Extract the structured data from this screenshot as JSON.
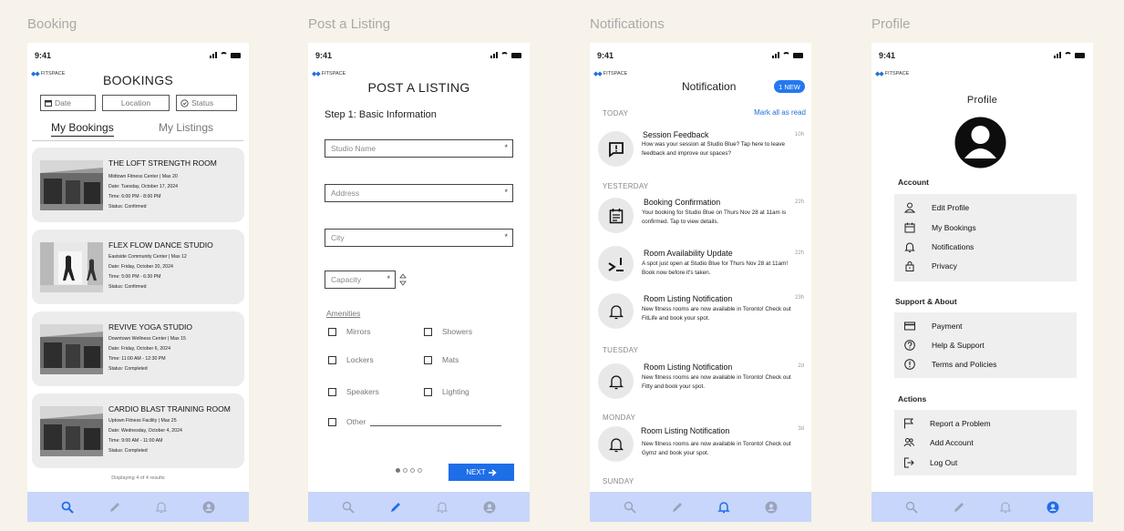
{
  "section_labels": {
    "booking": "Booking",
    "listing": "Post a Listing",
    "notifications": "Notifications",
    "profile": "Profile"
  },
  "status_time": "9:41",
  "brand": "FITSPACE",
  "colors": {
    "accent": "#1e6ee8",
    "navbar": "#c9d6fb",
    "background": "#f7f3ea",
    "card": "#ececec"
  },
  "booking": {
    "title": "BOOKINGS",
    "filters": [
      {
        "icon": "calendar-icon",
        "label": "Date"
      },
      {
        "label": "Location"
      },
      {
        "icon": "status-icon",
        "label": "Status"
      }
    ],
    "tabs": {
      "active": "My Bookings",
      "inactive": "My Listings"
    },
    "cards": [
      {
        "title": "THE LOFT STRENGTH ROOM",
        "lines": [
          "Midtown Fitness Center | Max 20",
          "Date: Tuesday, October 17, 2024",
          "Time: 6:00 PM - 8:00 PM",
          "Status: Confirmed"
        ]
      },
      {
        "title": "FLEX FLOW DANCE STUDIO",
        "lines": [
          "Eastside Community Center | Max 12",
          "Date: Friday, October 20, 2024",
          "Time: 5:00 PM - 6:30 PM",
          "Status: Confirmed"
        ]
      },
      {
        "title": "REVIVE YOGA STUDIO",
        "lines": [
          "Downtown Wellness Center | Max 15",
          "Date: Friday, October 6, 2024",
          "Time: 11:00 AM - 12:30 PM",
          "Status: Completed"
        ]
      },
      {
        "title": "CARDIO BLAST TRAINING ROOM",
        "lines": [
          "Uptown Fitness Facility | Max 25",
          "Date: Wednesday, October 4, 2024",
          "Time: 9:00 AM - 11:00 AM",
          "Status: Completed"
        ]
      }
    ],
    "results": "Displaying 4 of 4 results"
  },
  "listing": {
    "title": "POST A LISTING",
    "step": "Step 1: Basic Information",
    "fields": {
      "studio": "Studio Name",
      "address": "Address",
      "city": "City",
      "capacity": "Capacity",
      "required": "*"
    },
    "amenities_title": "Amenities",
    "amenities": [
      "Mirrors",
      "Showers",
      "Lockers",
      "Mats",
      "Speakers",
      "Lighting",
      "Other"
    ],
    "next": "NEXT",
    "page_indicator": {
      "total": 4,
      "current": 1
    }
  },
  "notifications": {
    "title": "Notification",
    "badge": "1 NEW",
    "mark_all": "Mark all as read",
    "days": [
      "TODAY",
      "YESTERDAY",
      "TUESDAY",
      "MONDAY",
      "SUNDAY"
    ],
    "items": [
      {
        "title": "Session Feedback",
        "body": "How was your session at Studio Blue? Tap here to leave feedback and improve our spaces?",
        "time": "10h",
        "icon": "feedback-icon"
      },
      {
        "title": "Booking Confirmation",
        "body": "Your booking for Studio Blue on Thurs Nov 28 at 11am is confirmed. Tap to view details.",
        "time": "22h",
        "icon": "calendar-icon"
      },
      {
        "title": "Room Availability Update",
        "body": "A spot just open at Studio Blue for Thurs Nov 28 at 11am! Book now before it's taken.",
        "time": "22h",
        "icon": "availability-icon"
      },
      {
        "title": "Room Listing Notification",
        "body": "New fitness rooms are now available in Toronto! Check out FitLife and book your spot.",
        "time": "23h",
        "icon": "bell-icon"
      },
      {
        "title": "Room Listing Notification",
        "body": "New fitness rooms are now available in Toronto! Check out Fitty and book your spot.",
        "time": "2d",
        "icon": "bell-icon"
      },
      {
        "title": "Room Listing Notification",
        "body": "New fitness rooms are now available in Toronto! Check out Gymz and book your spot.",
        "time": "3d",
        "icon": "bell-icon"
      }
    ]
  },
  "profile": {
    "title": "Profile",
    "sections": {
      "account": "Account",
      "support": "Support & About",
      "actions": "Actions"
    },
    "account_items": [
      "Edit Profile",
      "My Bookings",
      "Notifications",
      "Privacy"
    ],
    "support_items": [
      "Payment",
      "Help & Support",
      "Terms and Policies"
    ],
    "action_items": [
      "Report a Problem",
      "Add Account",
      "Log Out"
    ]
  },
  "navbar": {
    "items": [
      "search-icon",
      "pencil-icon",
      "bell-icon",
      "profile-icon"
    ]
  }
}
